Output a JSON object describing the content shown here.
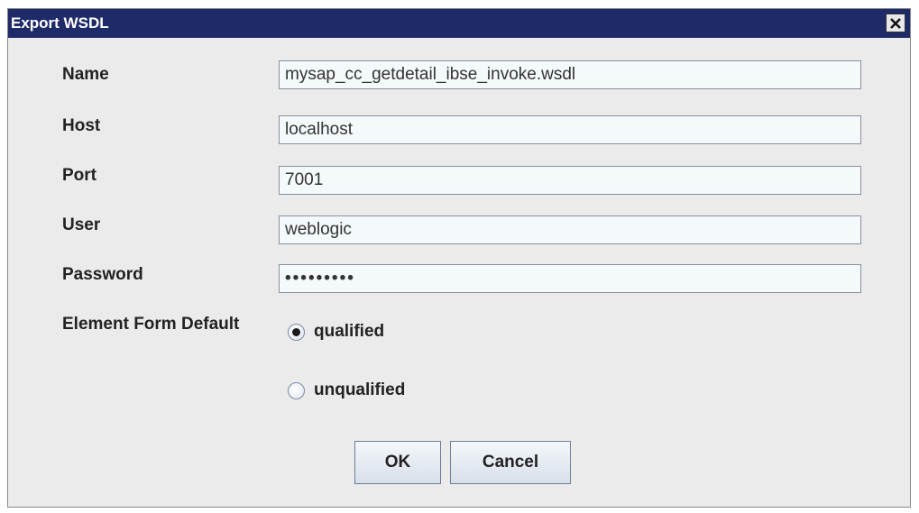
{
  "dialog": {
    "title": "Export WSDL",
    "close_icon": "close-icon"
  },
  "form": {
    "name_label": "Name",
    "name_value": "mysap_cc_getdetail_ibse_invoke.wsdl",
    "host_label": "Host",
    "host_value": "localhost",
    "port_label": "Port",
    "port_value": "7001",
    "user_label": "User",
    "user_value": "weblogic",
    "password_label": "Password",
    "password_value": "•••••••••",
    "element_form_default_label": "Element Form Default",
    "options": [
      {
        "label": "qualified",
        "selected": true
      },
      {
        "label": "unqualified",
        "selected": false
      }
    ]
  },
  "buttons": {
    "ok_label": "OK",
    "cancel_label": "Cancel"
  },
  "colors": {
    "titlebar": "#1f2a69",
    "dialog_bg": "#ebebeb",
    "field_bg": "#f4f9fb"
  }
}
